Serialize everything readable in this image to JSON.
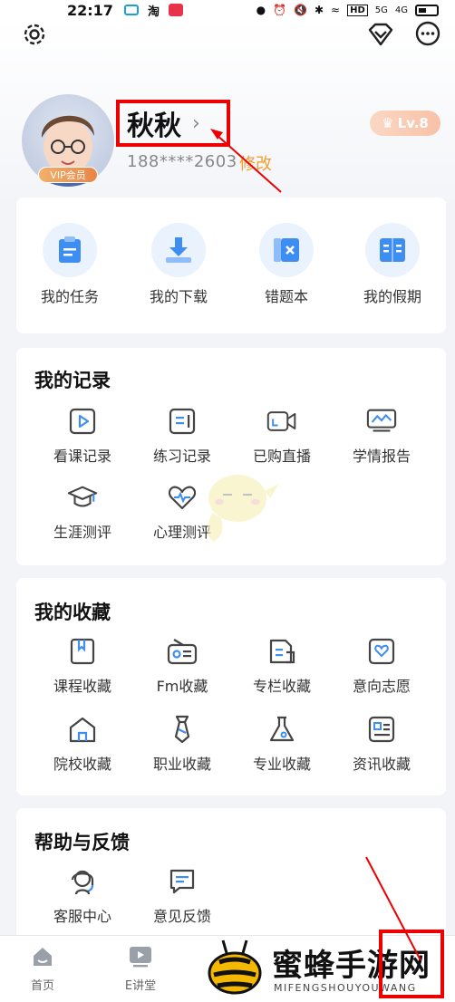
{
  "status_bar": {
    "time": "22:17",
    "apps": [
      "淘"
    ],
    "icons": [
      "bilibili-icon",
      "taobao-icon",
      "app-badge-icon",
      "location-icon",
      "alarm-icon",
      "mute-icon",
      "bluetooth-icon",
      "wifi-icon",
      "hd-icon",
      "signal-5g-icon",
      "signal-4g-icon",
      "battery-icon"
    ],
    "network_labels": [
      "HD",
      "5G",
      "4G"
    ]
  },
  "header": {
    "settings_icon": "gear-icon",
    "vip_icon": "diamond-icon",
    "message_icon": "chat-icon"
  },
  "profile": {
    "username": "秋秋",
    "vip_tag": "VIP会员",
    "phone": "188****2603",
    "edit_label": "修改",
    "level": "Lv.8"
  },
  "quick_actions": [
    {
      "label": "我的任务",
      "icon": "clipboard-icon"
    },
    {
      "label": "我的下载",
      "icon": "download-icon"
    },
    {
      "label": "错题本",
      "icon": "wrongbook-icon"
    },
    {
      "label": "我的假期",
      "icon": "book-icon"
    }
  ],
  "records": {
    "title": "我的记录",
    "items": [
      {
        "label": "看课记录",
        "icon": "play-record-icon"
      },
      {
        "label": "练习记录",
        "icon": "practice-icon"
      },
      {
        "label": "已购直播",
        "icon": "live-camera-icon"
      },
      {
        "label": "学情报告",
        "icon": "report-monitor-icon"
      },
      {
        "label": "生涯测评",
        "icon": "graduation-cap-icon"
      },
      {
        "label": "心理测评",
        "icon": "heart-pulse-icon"
      }
    ]
  },
  "favorites": {
    "title": "我的收藏",
    "items": [
      {
        "label": "课程收藏",
        "icon": "bookmark-book-icon"
      },
      {
        "label": "Fm收藏",
        "icon": "radio-icon"
      },
      {
        "label": "专栏收藏",
        "icon": "column-doc-icon"
      },
      {
        "label": "意向志愿",
        "icon": "heart-card-icon"
      },
      {
        "label": "院校收藏",
        "icon": "school-icon"
      },
      {
        "label": "职业收藏",
        "icon": "tie-icon"
      },
      {
        "label": "专业收藏",
        "icon": "flask-icon"
      },
      {
        "label": "资讯收藏",
        "icon": "news-icon"
      }
    ]
  },
  "help": {
    "title": "帮助与反馈",
    "items": [
      {
        "label": "客服中心",
        "icon": "headset-icon"
      },
      {
        "label": "意见反馈",
        "icon": "feedback-icon"
      }
    ]
  },
  "bottom_nav": [
    {
      "label": "首页",
      "icon": "home-icon"
    },
    {
      "label": "E讲堂",
      "icon": "video-icon"
    }
  ],
  "watermark": {
    "title": "蜜蜂手游网",
    "subtitle": "MIFENGSHOUYOUWANG"
  },
  "colors": {
    "accent_blue": "#3d8ef0",
    "icon_bg": "#eaf2fd",
    "orange": "#f0a030",
    "annotation_red": "#e00000"
  }
}
